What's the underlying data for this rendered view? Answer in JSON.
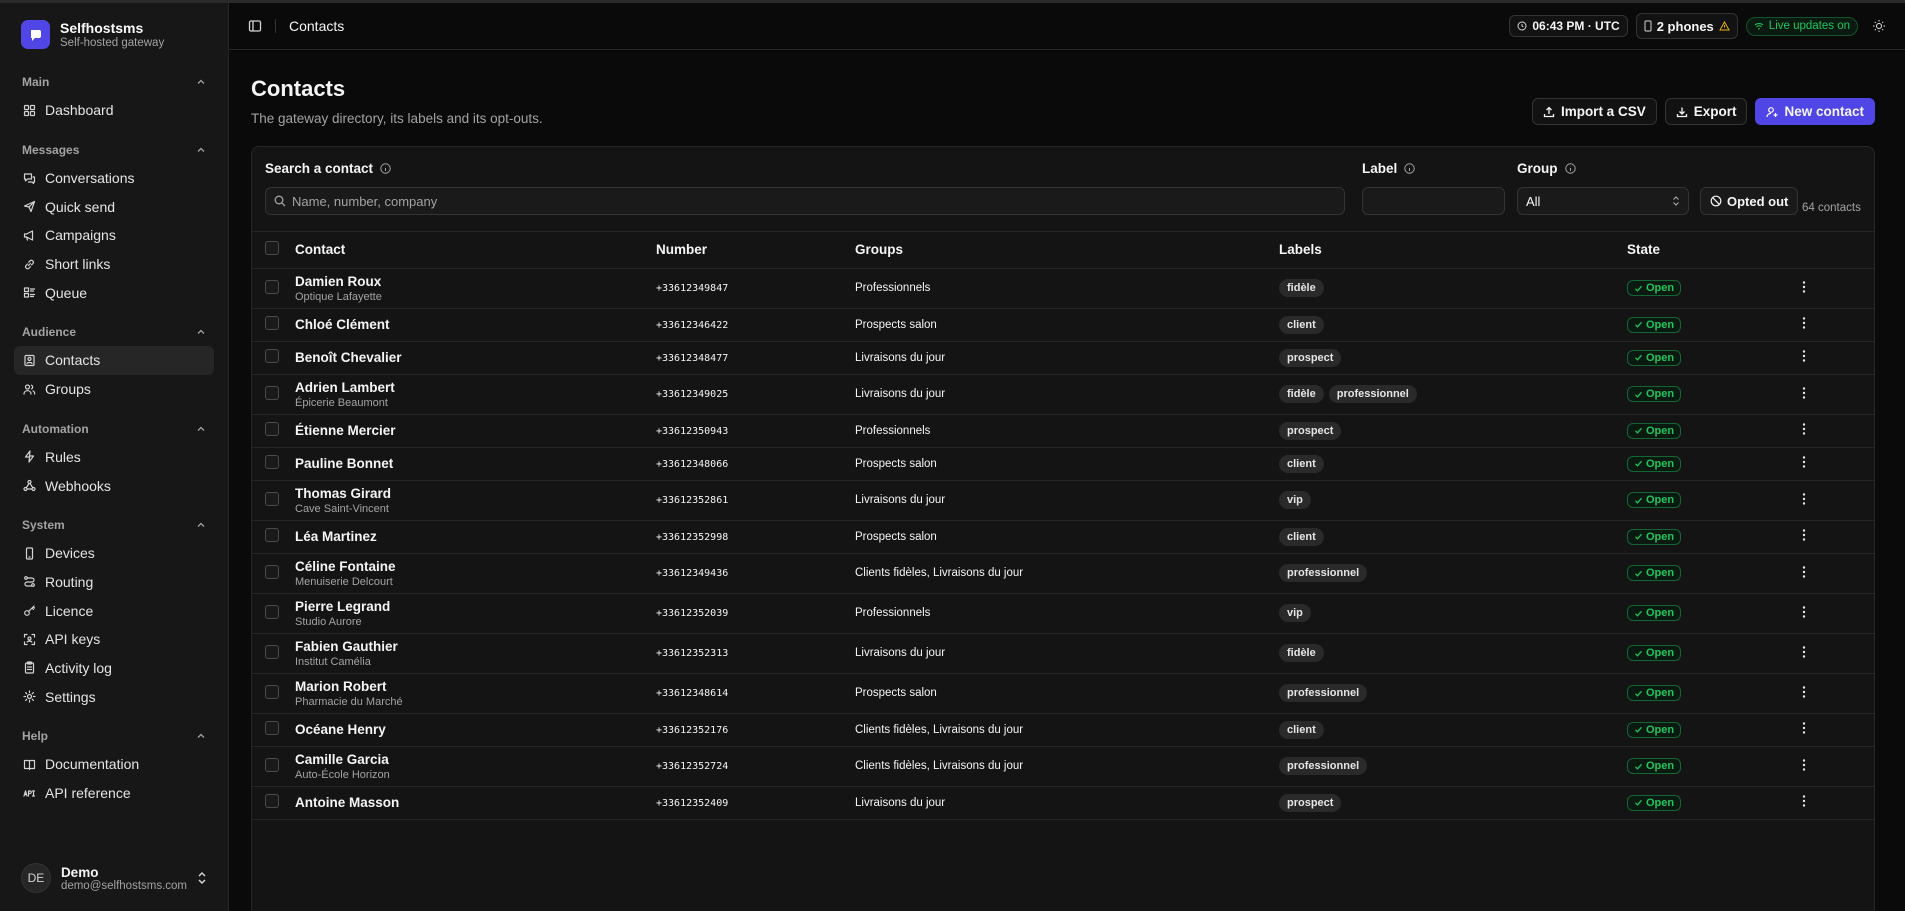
{
  "brand": {
    "title": "Selfhostsms",
    "subtitle": "Self-hosted gateway"
  },
  "sidebar": {
    "sections": [
      {
        "label": "Main",
        "items": [
          {
            "label": "Dashboard",
            "icon": "dashboard-icon"
          }
        ]
      },
      {
        "label": "Messages",
        "items": [
          {
            "label": "Conversations",
            "icon": "conversations-icon"
          },
          {
            "label": "Quick send",
            "icon": "send-icon"
          },
          {
            "label": "Campaigns",
            "icon": "megaphone-icon"
          },
          {
            "label": "Short links",
            "icon": "link-icon"
          },
          {
            "label": "Queue",
            "icon": "queue-icon"
          }
        ]
      },
      {
        "label": "Audience",
        "items": [
          {
            "label": "Contacts",
            "icon": "contacts-icon",
            "active": true
          },
          {
            "label": "Groups",
            "icon": "users-icon"
          }
        ]
      },
      {
        "label": "Automation",
        "items": [
          {
            "label": "Rules",
            "icon": "bolt-icon"
          },
          {
            "label": "Webhooks",
            "icon": "webhook-icon"
          }
        ]
      },
      {
        "label": "System",
        "items": [
          {
            "label": "Devices",
            "icon": "phone-icon"
          },
          {
            "label": "Routing",
            "icon": "routing-icon"
          },
          {
            "label": "Licence",
            "icon": "key-icon"
          },
          {
            "label": "API keys",
            "icon": "scan-icon"
          },
          {
            "label": "Activity log",
            "icon": "clipboard-icon"
          },
          {
            "label": "Settings",
            "icon": "gear-icon"
          }
        ]
      },
      {
        "label": "Help",
        "items": [
          {
            "label": "Documentation",
            "icon": "book-icon"
          },
          {
            "label": "API reference",
            "icon": "api-icon"
          }
        ]
      }
    ]
  },
  "user": {
    "initials": "DE",
    "name": "Demo",
    "email": "demo@selfhostsms.com"
  },
  "topbar": {
    "crumb": "Contacts",
    "time": "06:43 PM · UTC",
    "phones": "2 phones",
    "live": "Live updates on"
  },
  "page": {
    "title": "Contacts",
    "description": "The gateway directory, its labels and its opt-outs."
  },
  "actions": {
    "import": "Import a CSV",
    "export": "Export",
    "new": "New contact"
  },
  "filters": {
    "search_label": "Search a contact",
    "search_placeholder": "Name, number, company",
    "label_label": "Label",
    "group_label": "Group",
    "group_value": "All",
    "opted_out": "Opted out",
    "count": "64 contacts"
  },
  "table": {
    "columns": [
      "Contact",
      "Number",
      "Groups",
      "Labels",
      "State"
    ],
    "rows": [
      {
        "name": "Damien Roux",
        "company": "Optique Lafayette",
        "number": "+33612349847",
        "groups": "Professionnels",
        "labels": [
          "fidèle"
        ],
        "state": "Open"
      },
      {
        "name": "Chloé Clément",
        "company": "",
        "number": "+33612346422",
        "groups": "Prospects salon",
        "labels": [
          "client"
        ],
        "state": "Open"
      },
      {
        "name": "Benoît Chevalier",
        "company": "",
        "number": "+33612348477",
        "groups": "Livraisons du jour",
        "labels": [
          "prospect"
        ],
        "state": "Open"
      },
      {
        "name": "Adrien Lambert",
        "company": "Épicerie Beaumont",
        "number": "+33612349025",
        "groups": "Livraisons du jour",
        "labels": [
          "fidèle",
          "professionnel"
        ],
        "state": "Open"
      },
      {
        "name": "Étienne Mercier",
        "company": "",
        "number": "+33612350943",
        "groups": "Professionnels",
        "labels": [
          "prospect"
        ],
        "state": "Open"
      },
      {
        "name": "Pauline Bonnet",
        "company": "",
        "number": "+33612348066",
        "groups": "Prospects salon",
        "labels": [
          "client"
        ],
        "state": "Open"
      },
      {
        "name": "Thomas Girard",
        "company": "Cave Saint-Vincent",
        "number": "+33612352861",
        "groups": "Livraisons du jour",
        "labels": [
          "vip"
        ],
        "state": "Open"
      },
      {
        "name": "Léa Martinez",
        "company": "",
        "number": "+33612352998",
        "groups": "Prospects salon",
        "labels": [
          "client"
        ],
        "state": "Open"
      },
      {
        "name": "Céline Fontaine",
        "company": "Menuiserie Delcourt",
        "number": "+33612349436",
        "groups": "Clients fidèles, Livraisons du jour",
        "labels": [
          "professionnel"
        ],
        "state": "Open"
      },
      {
        "name": "Pierre Legrand",
        "company": "Studio Aurore",
        "number": "+33612352039",
        "groups": "Professionnels",
        "labels": [
          "vip"
        ],
        "state": "Open"
      },
      {
        "name": "Fabien Gauthier",
        "company": "Institut Camélia",
        "number": "+33612352313",
        "groups": "Livraisons du jour",
        "labels": [
          "fidèle"
        ],
        "state": "Open"
      },
      {
        "name": "Marion Robert",
        "company": "Pharmacie du Marché",
        "number": "+33612348614",
        "groups": "Prospects salon",
        "labels": [
          "professionnel"
        ],
        "state": "Open"
      },
      {
        "name": "Océane Henry",
        "company": "",
        "number": "+33612352176",
        "groups": "Clients fidèles, Livraisons du jour",
        "labels": [
          "client"
        ],
        "state": "Open"
      },
      {
        "name": "Camille Garcia",
        "company": "Auto-École Horizon",
        "number": "+33612352724",
        "groups": "Clients fidèles, Livraisons du jour",
        "labels": [
          "professionnel"
        ],
        "state": "Open"
      },
      {
        "name": "Antoine Masson",
        "company": "",
        "number": "+33612352409",
        "groups": "Livraisons du jour",
        "labels": [
          "prospect"
        ],
        "state": "Open"
      }
    ]
  },
  "colors": {
    "accent": "#4f46e5",
    "success": "#22c55e",
    "warning": "#eab308"
  }
}
